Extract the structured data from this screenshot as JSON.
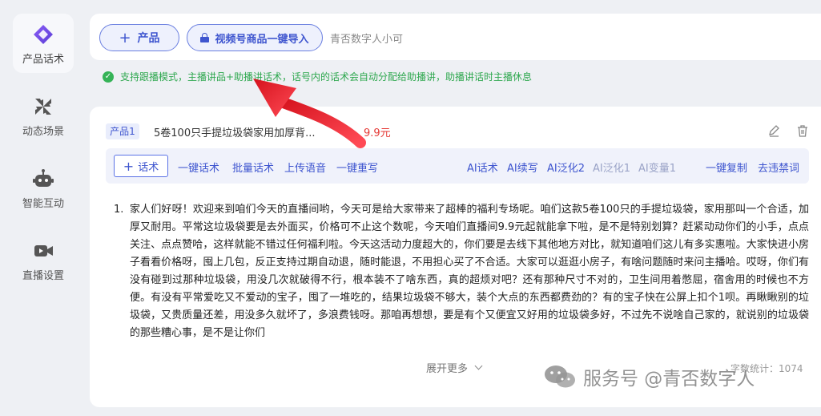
{
  "sidebar": {
    "items": [
      {
        "label": "产品话术",
        "icon": "diamond-icon",
        "active": true
      },
      {
        "label": "动态场景",
        "icon": "pinwheel-icon",
        "active": false
      },
      {
        "label": "智能互动",
        "icon": "robot-icon",
        "active": false
      },
      {
        "label": "直播设置",
        "icon": "video-camera-icon",
        "active": false
      }
    ]
  },
  "topbar": {
    "product_button": "产品",
    "import_button": "视频号商品一键导入",
    "user_name": "青否数字人小可"
  },
  "notice": {
    "text": "支持跟播模式，主播讲品+助播讲话术，话号内的话术会自动分配给助播讲，助播讲话时主播休息"
  },
  "product": {
    "tag": "产品1",
    "title": "5卷100只手提垃圾袋家用加厚背...",
    "price": "9.9元"
  },
  "toolbar": {
    "add_label": "话术",
    "left_links": [
      "一键话术",
      "批量话术",
      "上传语音",
      "一键重写"
    ],
    "ai_links": [
      {
        "label": "AI话术",
        "disabled": false
      },
      {
        "label": "AI续写",
        "disabled": false
      },
      {
        "label": "AI泛化2",
        "disabled": false
      },
      {
        "label": "AI泛化1",
        "disabled": true
      },
      {
        "label": "AI变量1",
        "disabled": true
      }
    ],
    "right_links": [
      "一键复制",
      "去违禁词"
    ]
  },
  "script": {
    "number": "1.",
    "text": "家人们好呀！欢迎来到咱们今天的直播间哟，今天可是给大家带来了超棒的福利专场呢。咱们这款5卷100只的手提垃圾袋，家用那叫一个合适，加厚又耐用。平常这垃圾袋要是去外面买，价格可不止这个数呢，今天咱们直播间9.9元起就能拿下啦，是不是特别划算？赶紧动动你们的小手，点点关注、点点赞哈，这样就能不错过任何福利啦。今天这活动力度超大的，你们要是去线下其他地方对比，就知道咱们这儿有多实惠啦。大家快进小房子看看价格呀，囤上几包，反正支持过期自动退，随时能退，不用担心买了不合适。大家可以逛逛小房子，有啥问题随时来问主播哈。哎呀，你们有没有碰到过那种垃圾袋，用没几次就破得不行，根本装不了啥东西，真的超烦对吧？还有那种尺寸不对的，卫生间用着憋屈，宿舍用的时候也不方便。有没有平常爱吃又不爱动的宝子，囤了一堆吃的，结果垃圾袋不够大，装个大点的东西都费劲的？有的宝子快在公屏上扣个1呗。再瞅瞅别的垃圾袋，又贵质量还差，用没多久就坏了，多浪费钱呀。那咱再想想，要是有个又便宜又好用的垃圾袋多好，不过先不说啥自己家的，就说别的垃圾袋的那些糟心事，是不是让你们"
  },
  "footer": {
    "expand_label": "展开更多",
    "word_count": "字数统计：1074"
  },
  "watermark": {
    "text": "服务号 @青否数字人"
  },
  "colors": {
    "accent": "#3e55cf",
    "success": "#2fa84f",
    "price": "#e53935",
    "arrow": "#e8242f"
  }
}
